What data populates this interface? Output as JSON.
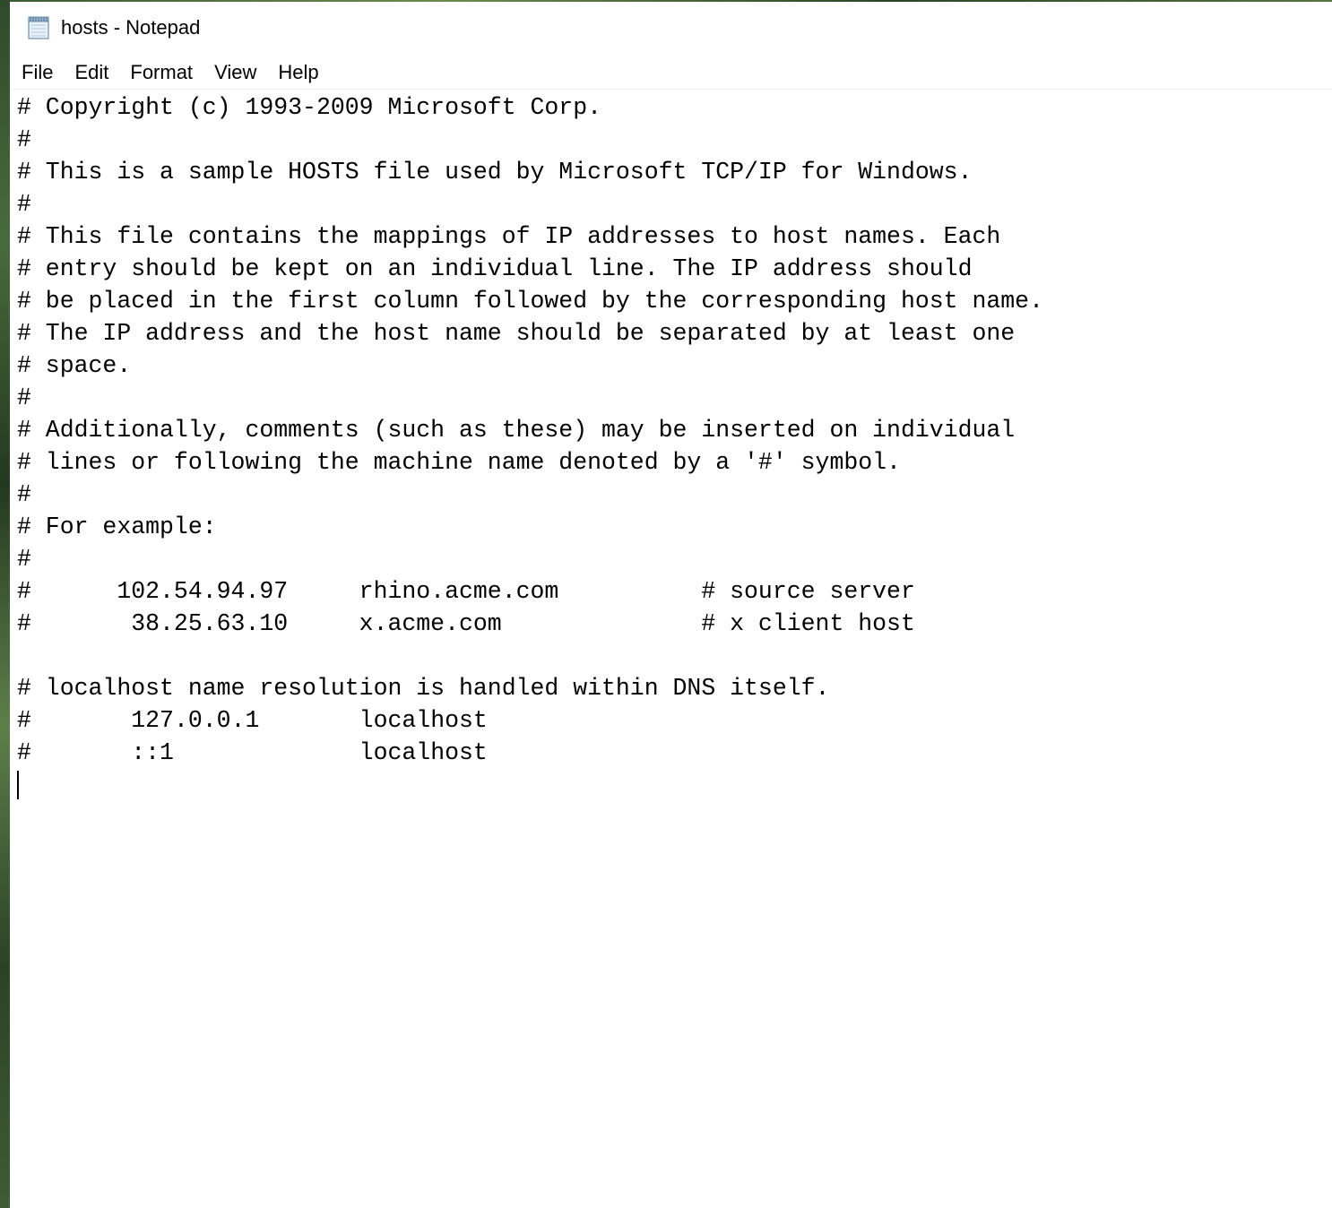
{
  "window": {
    "title": "hosts - Notepad",
    "app_icon": "notepad-icon"
  },
  "menubar": {
    "items": [
      "File",
      "Edit",
      "Format",
      "View",
      "Help"
    ]
  },
  "editor": {
    "content": "# Copyright (c) 1993-2009 Microsoft Corp.\n#\n# This is a sample HOSTS file used by Microsoft TCP/IP for Windows.\n#\n# This file contains the mappings of IP addresses to host names. Each\n# entry should be kept on an individual line. The IP address should\n# be placed in the first column followed by the corresponding host name.\n# The IP address and the host name should be separated by at least one\n# space.\n#\n# Additionally, comments (such as these) may be inserted on individual\n# lines or following the machine name denoted by a '#' symbol.\n#\n# For example:\n#\n#      102.54.94.97     rhino.acme.com          # source server\n#       38.25.63.10     x.acme.com              # x client host\n\n# localhost name resolution is handled within DNS itself.\n#\t127.0.0.1       localhost\n#\t::1             localhost\n"
  }
}
